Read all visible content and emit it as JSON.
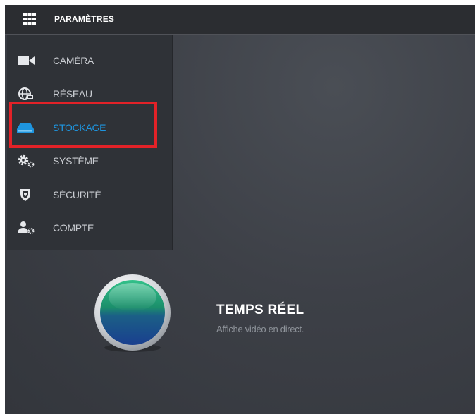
{
  "header": {
    "title": "PARAMÈTRES",
    "menu_icon": "grid-icon"
  },
  "menu": {
    "items": [
      {
        "label": "CAMÉRA",
        "icon": "camera-icon",
        "active": false
      },
      {
        "label": "RÉSEAU",
        "icon": "network-globe-icon",
        "active": false
      },
      {
        "label": "STOCKAGE",
        "icon": "storage-drive-icon",
        "active": true
      },
      {
        "label": "SYSTÈME",
        "icon": "gears-icon",
        "active": false
      },
      {
        "label": "SÉCURITÉ",
        "icon": "shield-icon",
        "active": false
      },
      {
        "label": "COMPTE",
        "icon": "user-settings-icon",
        "active": false
      }
    ]
  },
  "live": {
    "title": "TEMPS RÉEL",
    "description": "Affiche vidéo en direct.",
    "icon": "live-view-orb-icon"
  },
  "colors": {
    "accent": "#1e95df",
    "highlight": "#e32228",
    "menu_text": "#c9ccd1",
    "background": "#3d4047"
  }
}
